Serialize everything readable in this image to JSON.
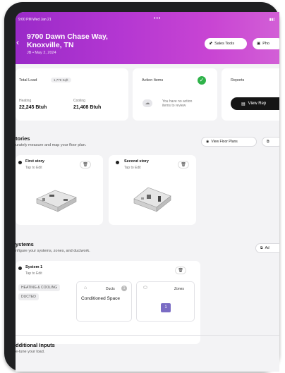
{
  "status_bar": {
    "time_date": "9:00 PM  Wed Jan 21",
    "dots": "•••"
  },
  "header": {
    "address_line1": "9700 Dawn Chase Way,",
    "address_line2": "Knoxville, TN",
    "subtitle": "JB • May 2, 2024",
    "sales_tools_label": "Sales Tools",
    "photos_label": "Pho"
  },
  "load": {
    "title": "Total Load",
    "sqft": "1,778 Sqft",
    "heating_label": "Heating",
    "heating_value": "22,245 Btuh",
    "cooling_label": "Cooling",
    "cooling_value": "21,408 Btuh"
  },
  "action_items": {
    "title": "Action Items",
    "message_line1": "You have no action",
    "message_line2": "items to review"
  },
  "reports": {
    "title": "Reports",
    "button_label": "View Rep"
  },
  "stories": {
    "title": "tories",
    "subtitle": "urately measure and map your floor plan.",
    "view_floor_plans_label": "View Floor Plans",
    "items": [
      {
        "name": "First story",
        "hint": "Tap to Edit"
      },
      {
        "name": "Second story",
        "hint": "Tap to Edit"
      }
    ]
  },
  "systems": {
    "title": "ystems",
    "subtitle": "nfigure your systems, zones, and ductwork.",
    "add_label": "Ad",
    "system": {
      "name": "System 1",
      "hint": "Tap to Edit",
      "tag1": "HEATING & COOLING",
      "tag2": "DUCTED",
      "ducts_label": "Ducts",
      "ducts_count": "1",
      "ducts_space": "Conditioned Space",
      "zones_label": "Zones",
      "zone_number": "1"
    }
  },
  "additional": {
    "title": "dditional Inputs",
    "subtitle": "e-tune your load."
  },
  "colors": {
    "header_gradient_start": "#9a2ac8",
    "header_gradient_end": "#d25fd6",
    "check_green": "#2fb34a",
    "zone_badge": "#7a6cc4"
  }
}
